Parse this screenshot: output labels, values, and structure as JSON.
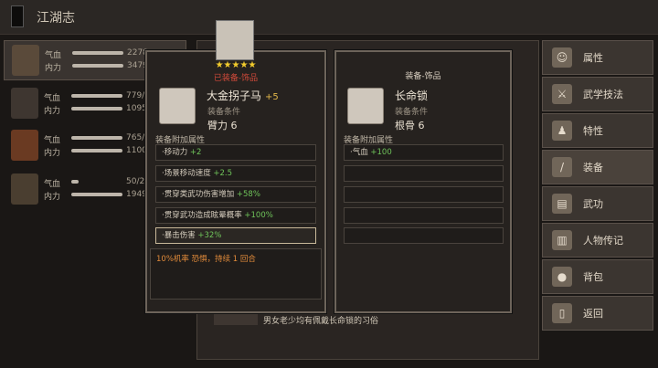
{
  "page": {
    "title": "江湖志"
  },
  "characters": [
    {
      "qi_label": "气血",
      "qi_value": "2278",
      "nei_label": "内力",
      "nei_value": "3479"
    },
    {
      "qi_label": "气血",
      "qi_value": "779/",
      "nei_label": "内力",
      "nei_value": "1095"
    },
    {
      "qi_label": "气血",
      "qi_value": "765/",
      "nei_label": "内力",
      "nei_value": "1100"
    },
    {
      "qi_label": "气血",
      "qi_value": "50/2",
      "nei_label": "内力",
      "nei_value": "1949"
    }
  ],
  "menu": [
    {
      "label": "属性",
      "icon": "person-icon"
    },
    {
      "label": "武学技法",
      "icon": "martial-icon"
    },
    {
      "label": "特性",
      "icon": "trait-icon"
    },
    {
      "label": "装备",
      "icon": "sword-icon"
    },
    {
      "label": "武功",
      "icon": "book-icon"
    },
    {
      "label": "人物传记",
      "icon": "bio-icon"
    },
    {
      "label": "背包",
      "icon": "bag-icon"
    },
    {
      "label": "返回",
      "icon": "back-icon"
    }
  ],
  "left_tooltip": {
    "stars": "★★★★★",
    "equipped": "已装备-饰品",
    "name": "大金拐子马",
    "plus": "+5",
    "req_label": "装备条件",
    "req_value": "臂力 6",
    "attr_section": "装备附加属性",
    "attrs": [
      {
        "text": "·移动力",
        "value": "+2"
      },
      {
        "text": "·场景移动速度",
        "value": "+2.5"
      },
      {
        "text": "·贯穿类武功伤害增加",
        "value": "+58%"
      },
      {
        "text": "·贯穿武功造成眩晕概率",
        "value": "+100%"
      },
      {
        "text": "·暴击伤害",
        "value": "+32%"
      }
    ],
    "effect": "10%机率 恐惧，持续 1 回合"
  },
  "right_tooltip": {
    "title": "装备-饰品",
    "name": "长命锁",
    "req_label": "装备条件",
    "req_value": "根骨 6",
    "attr_section": "装备附加属性",
    "attrs": [
      {
        "text": "·气血",
        "value": "+100"
      }
    ]
  },
  "mid_desc": "男女老少均有佩戴长命锁的习俗"
}
